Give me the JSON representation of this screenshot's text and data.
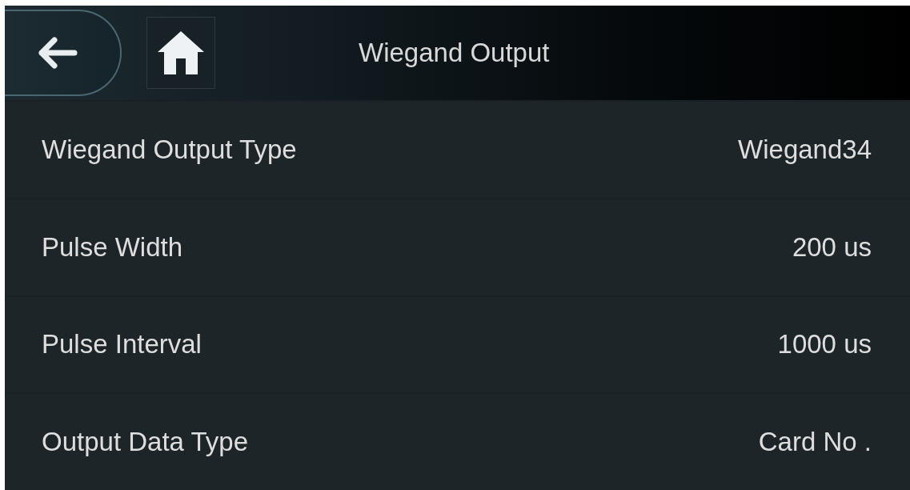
{
  "header": {
    "title": "Wiegand Output"
  },
  "settings": [
    {
      "label": "Wiegand Output Type",
      "value": "Wiegand34"
    },
    {
      "label": "Pulse Width",
      "value": "200 us"
    },
    {
      "label": "Pulse Interval",
      "value": "1000 us"
    },
    {
      "label": "Output Data Type",
      "value": "Card No ."
    }
  ]
}
